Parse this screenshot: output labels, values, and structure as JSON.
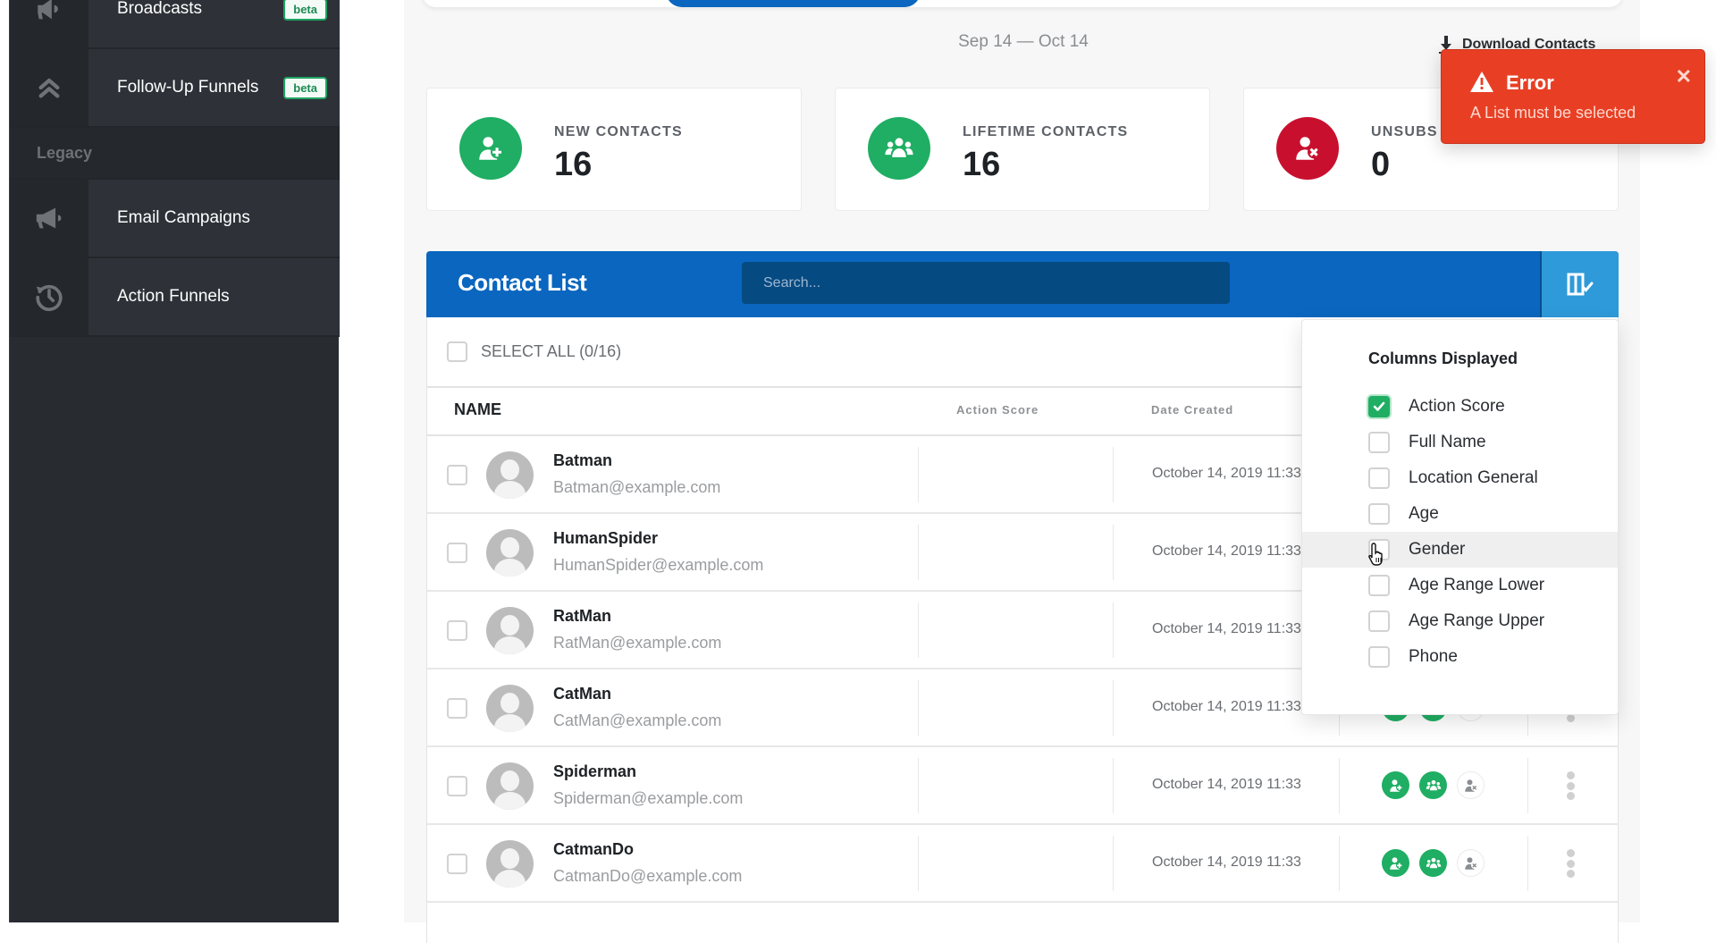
{
  "sidebar": {
    "items": [
      {
        "label": "Broadcasts",
        "icon": "bullhorn-icon",
        "badge": "beta"
      },
      {
        "label": "Follow-Up Funnels",
        "icon": "double-chevron-up-icon",
        "badge": "beta"
      },
      {
        "label": "Email Campaigns",
        "icon": "megaphone-icon",
        "badge": null
      },
      {
        "label": "Action Funnels",
        "icon": "history-icon",
        "badge": null
      }
    ],
    "section_label": "Legacy"
  },
  "header": {
    "date_range": "Sep 14 — Oct 14",
    "download_label": "Download Contacts"
  },
  "stats": [
    {
      "label": "NEW CONTACTS",
      "value": "16",
      "icon": "user-plus-icon",
      "color": "#1fae63"
    },
    {
      "label": "LIFETIME CONTACTS",
      "value": "16",
      "icon": "users-icon",
      "color": "#1fae63"
    },
    {
      "label": "UNSUBS",
      "value": "0",
      "icon": "user-x-icon",
      "color": "#c8102e"
    }
  ],
  "contact_list": {
    "title": "Contact List",
    "search_placeholder": "Search...",
    "select_all_label": "SELECT ALL (0/16)",
    "columns": {
      "name": "NAME",
      "action_score": "Action Score",
      "date_created": "Date Created"
    },
    "rows": [
      {
        "name": "Batman",
        "email": "Batman@example.com",
        "date": "October 14, 2019 11:33"
      },
      {
        "name": "HumanSpider",
        "email": "HumanSpider@example.com",
        "date": "October 14, 2019 11:33"
      },
      {
        "name": "RatMan",
        "email": "RatMan@example.com",
        "date": "October 14, 2019 11:33"
      },
      {
        "name": "CatMan",
        "email": "CatMan@example.com",
        "date": "October 14, 2019 11:33"
      },
      {
        "name": "Spiderman",
        "email": "Spiderman@example.com",
        "date": "October 14, 2019 11:33"
      },
      {
        "name": "CatmanDo",
        "email": "CatmanDo@example.com",
        "date": "October 14, 2019 11:33"
      }
    ]
  },
  "columns_dropdown": {
    "title": "Columns Displayed",
    "options": [
      {
        "label": "Action Score",
        "checked": true
      },
      {
        "label": "Full Name",
        "checked": false
      },
      {
        "label": "Location General",
        "checked": false
      },
      {
        "label": "Age",
        "checked": false
      },
      {
        "label": "Gender",
        "checked": false,
        "hovered": true
      },
      {
        "label": "Age Range Lower",
        "checked": false
      },
      {
        "label": "Age Range Upper",
        "checked": false
      },
      {
        "label": "Phone",
        "checked": false
      }
    ]
  },
  "toast": {
    "title": "Error",
    "message": "A List must be selected",
    "color": "#e83f24"
  },
  "colors": {
    "primary": "#0a66bf",
    "success": "#1fae63",
    "danger": "#c8102e",
    "sidebar_bg": "#282c31"
  }
}
